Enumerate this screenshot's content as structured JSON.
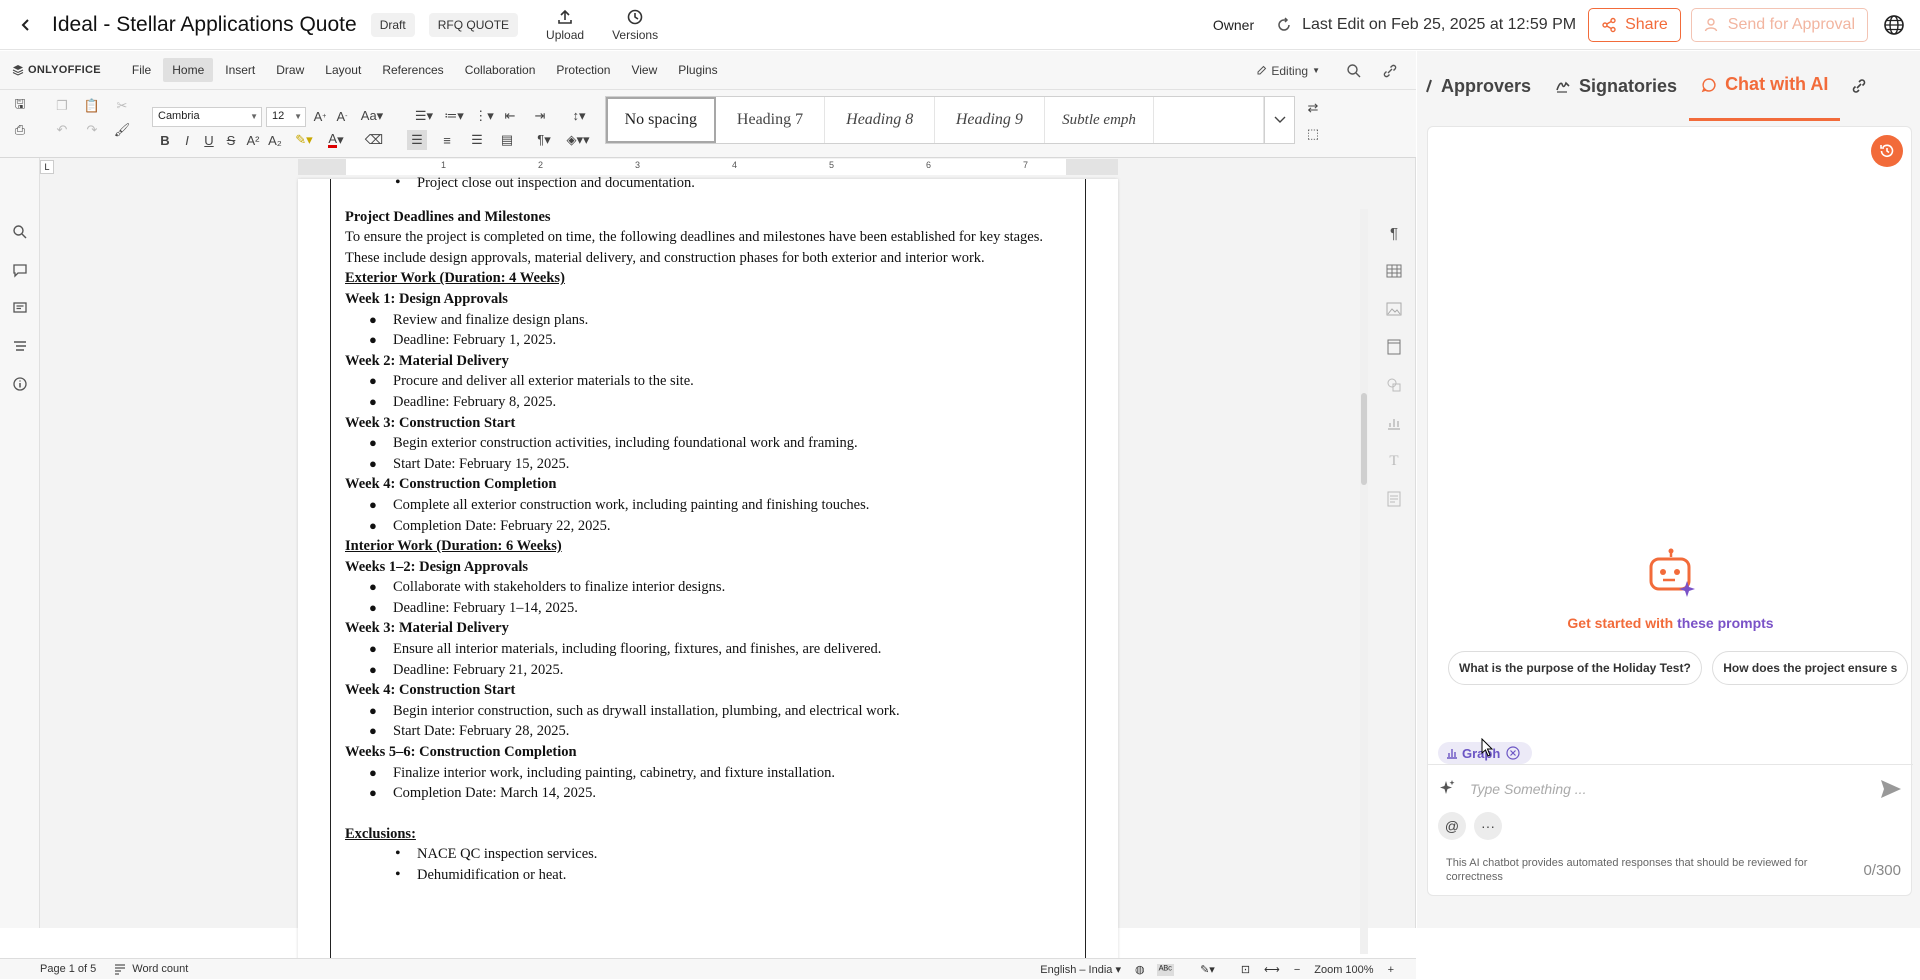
{
  "header": {
    "title": "Ideal - Stellar Applications Quote",
    "status_chip": "Draft",
    "type_chip": "RFQ QUOTE",
    "upload_label": "Upload",
    "versions_label": "Versions",
    "owner_label": "Owner",
    "last_edit": "Last Edit on Feb 25, 2025 at 12:59 PM",
    "share_label": "Share",
    "send_approval_label": "Send for Approval"
  },
  "editor": {
    "brand": "ONLYOFFICE",
    "menu": [
      "File",
      "Home",
      "Insert",
      "Draw",
      "Layout",
      "References",
      "Collaboration",
      "Protection",
      "View",
      "Plugins"
    ],
    "active_menu": "Home",
    "editing_mode": "Editing",
    "font_name": "Cambria",
    "font_size": "12",
    "styles": [
      "No spacing",
      "Heading 7",
      "Heading 8",
      "Heading 9",
      "Subtle emph",
      ""
    ],
    "ruler_numbers": [
      "1",
      "2",
      "3",
      "4",
      "5",
      "6",
      "7"
    ]
  },
  "document": {
    "top_bullet": "Project close out inspection and documentation.",
    "heading": "Project Deadlines and Milestones",
    "intro": "To ensure the project is completed on time, the following deadlines and milestones have been established for key stages. These include design approvals, material delivery, and construction phases for both exterior and interior work.",
    "exterior_heading": "Exterior Work (Duration: 4 Weeks)",
    "ext_w1": "Week 1: Design Approvals",
    "ext_w1_b1": "Review and finalize design plans.",
    "ext_w1_b2": "Deadline: February 1, 2025.",
    "ext_w2": "Week 2: Material Delivery",
    "ext_w2_b1": "Procure and deliver all exterior materials to the site.",
    "ext_w2_b2": "Deadline: February 8, 2025.",
    "ext_w3": "Week 3: Construction Start",
    "ext_w3_b1": "Begin exterior construction activities, including foundational work and framing.",
    "ext_w3_b2": "Start Date: February 15, 2025.",
    "ext_w4": "Week 4: Construction Completion",
    "ext_w4_b1": "Complete all exterior construction work, including painting and finishing touches.",
    "ext_w4_b2": "Completion Date: February 22, 2025.",
    "interior_heading": "Interior Work (Duration: 6 Weeks)",
    "int_w1": "Weeks 1–2: Design Approvals",
    "int_w1_b1": "Collaborate with stakeholders to finalize interior designs.",
    "int_w1_b2": "Deadline: February 1–14, 2025.",
    "int_w3": "Week 3: Material Delivery",
    "int_w3_b1": "Ensure all interior materials, including flooring, fixtures, and finishes, are delivered.",
    "int_w3_b2": "Deadline: February 21, 2025.",
    "int_w4": "Week 4: Construction Start",
    "int_w4_b1": "Begin interior construction, such as drywall installation, plumbing, and electrical work.",
    "int_w4_b2": "Start Date: February 28, 2025.",
    "int_w5": "Weeks 5–6: Construction Completion",
    "int_w5_b1": "Finalize interior work, including painting, cabinetry, and fixture installation.",
    "int_w5_b2": "Completion Date: March 14, 2025.",
    "exclusions_heading": "Exclusions:",
    "excl_b1": "NACE QC inspection services.",
    "excl_b2": "Dehumidification or heat."
  },
  "statusbar": {
    "page": "Page 1 of 5",
    "word_count": "Word count",
    "language": "English – India",
    "zoom": "Zoom 100%"
  },
  "panel": {
    "tabs": [
      "Approvers",
      "Signatories",
      "Chat with AI"
    ],
    "active_tab": "Chat with AI",
    "get_started_a": "Get started with",
    "get_started_b": "these prompts",
    "prompts": [
      "What is the purpose of the Holiday Test?",
      "How does the project ensure s"
    ],
    "graph_chip": "Graph",
    "input_placeholder": "Type Something ...",
    "at_label": "@",
    "more_label": "···",
    "disclaimer": "This AI chatbot provides automated responses that should be reviewed for correctness",
    "counter": "0/300"
  },
  "colors": {
    "accent": "#f26b3a",
    "purple": "#7a52c7"
  }
}
